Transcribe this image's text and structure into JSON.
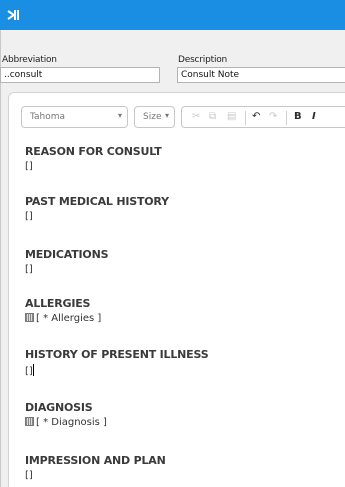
{
  "form": {
    "abbreviation_label": "Abbreviation",
    "abbreviation_value": "..consult",
    "description_label": "Description",
    "description_value": "Consult Note"
  },
  "toolbar": {
    "font_family": "Tahoma",
    "font_size_placeholder": "Size",
    "bold_label": "B",
    "italic_label": "I"
  },
  "document": {
    "sections": [
      {
        "heading": "REASON FOR CONSULT",
        "value": "[]"
      },
      {
        "heading": "PAST MEDICAL HISTORY",
        "value": "[]"
      },
      {
        "heading": "MEDICATIONS",
        "value": "[]"
      },
      {
        "heading": "ALLERGIES",
        "value": "[ * Allergies ]"
      },
      {
        "heading": "HISTORY OF PRESENT ILLNESS",
        "value": "[]"
      },
      {
        "heading": "DIAGNOSIS",
        "value": "[ * Diagnosis ]"
      },
      {
        "heading": "IMPRESSION AND PLAN",
        "value": "[]"
      }
    ]
  },
  "colors": {
    "titlebar": "#1a8ee2",
    "window_bg": "#f0f0f0"
  }
}
